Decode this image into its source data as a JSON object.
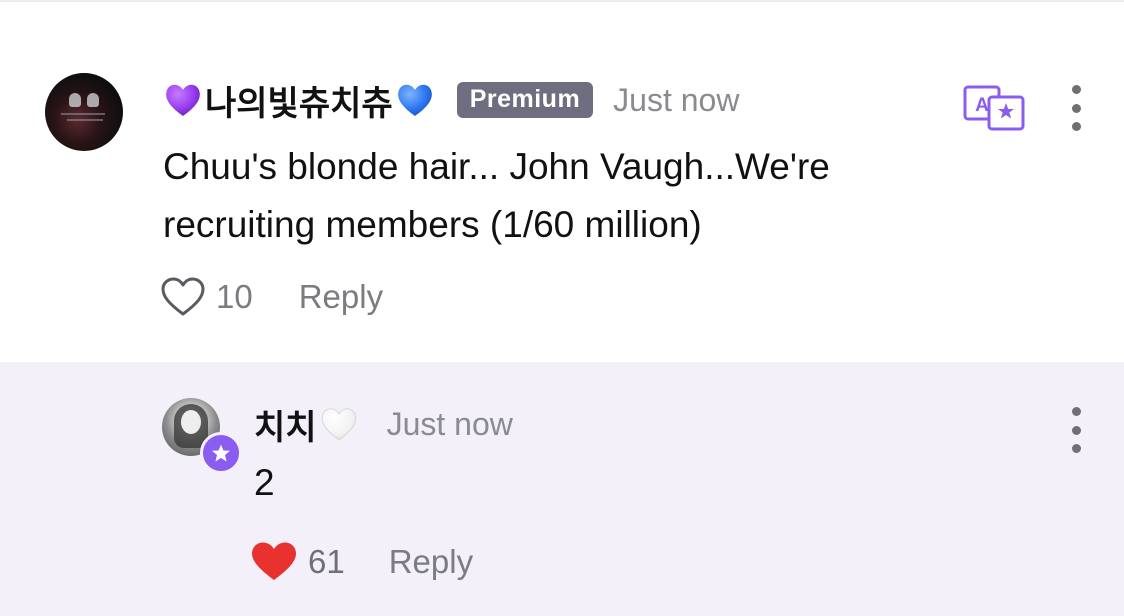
{
  "comment": {
    "author": {
      "emoji_left": "purple-heart",
      "name": "나의빛츄치츄",
      "emoji_right": "blue-heart"
    },
    "badge": "Premium",
    "timestamp": "Just now",
    "text_line1": "Chuu's blonde hair... John Vaugh...We're",
    "text_line2": "recruiting members (1/60 million)",
    "likes": "10",
    "liked": false,
    "reply_label": "Reply",
    "icons": {
      "translate": "translate-icon",
      "more": "more-vertical-icon",
      "like": "heart-outline-icon"
    }
  },
  "reply": {
    "author": {
      "name": "치치",
      "emoji_right": "white-heart"
    },
    "timestamp": "Just now",
    "text": "2",
    "likes": "61",
    "liked": true,
    "reply_label": "Reply",
    "icons": {
      "badge": "star-icon",
      "more": "more-vertical-icon",
      "like": "heart-filled-icon"
    }
  },
  "colors": {
    "purple_heart": "#9b3ff0",
    "blue_heart": "#2f7bf2",
    "premium_badge_bg": "#6e6e80",
    "translate_accent": "#8a5cf0",
    "like_red": "#e8322f",
    "reply_bg": "#f3f0f9",
    "muted_text": "#8a8a8f"
  }
}
